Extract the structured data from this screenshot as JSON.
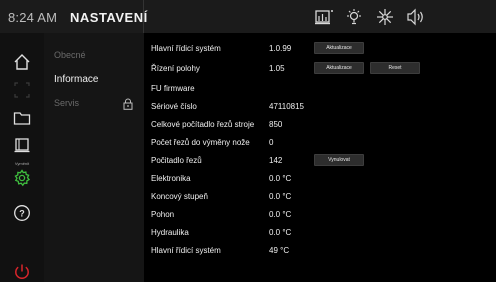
{
  "header": {
    "time": "8:24 AM",
    "title": "NASTAVENÍ"
  },
  "rail": {
    "items": [
      {
        "icon": "home-icon"
      },
      {
        "icon": "crop-corners-icon"
      },
      {
        "icon": "folder-icon"
      },
      {
        "icon": "cutter-icon",
        "label": "Vyměnit"
      },
      {
        "icon": "gear-icon"
      },
      {
        "icon": "help-icon"
      },
      {
        "icon": "power-icon"
      }
    ]
  },
  "submenu": {
    "items": [
      {
        "label": "Obecné"
      },
      {
        "label": "Informace"
      },
      {
        "label": "Servis"
      }
    ]
  },
  "info": {
    "rows": [
      {
        "label": "Hlavní řídicí systém",
        "value": "1.0.99",
        "button": "Aktualizace"
      },
      {
        "label": "Řízení polohy",
        "value": "1.05",
        "button": "Aktualizace",
        "button2": "Reset"
      },
      {
        "label": "FU firmware",
        "value": ""
      },
      {
        "label": "Sériové číslo",
        "value": "47110815"
      },
      {
        "label": "Celkové počítadlo řezů stroje",
        "value": "850"
      },
      {
        "label": "Počet řezů do výměny nože",
        "value": "0"
      },
      {
        "label": "Počitadlo řezů",
        "value": "142",
        "button": "Vynulovat"
      },
      {
        "label": "Elektronika",
        "value": "0.0 °C"
      },
      {
        "label": "Koncový stupeň",
        "value": "0.0 °C"
      },
      {
        "label": "Pohon",
        "value": "0.0 °C"
      },
      {
        "label": "Hydraulika",
        "value": "0.0 °C"
      },
      {
        "label": "Hlavní řídicí systém",
        "value": "49 °C"
      }
    ]
  },
  "colors": {
    "accent_green": "#3fbf3f",
    "power_red": "#d9252b"
  }
}
